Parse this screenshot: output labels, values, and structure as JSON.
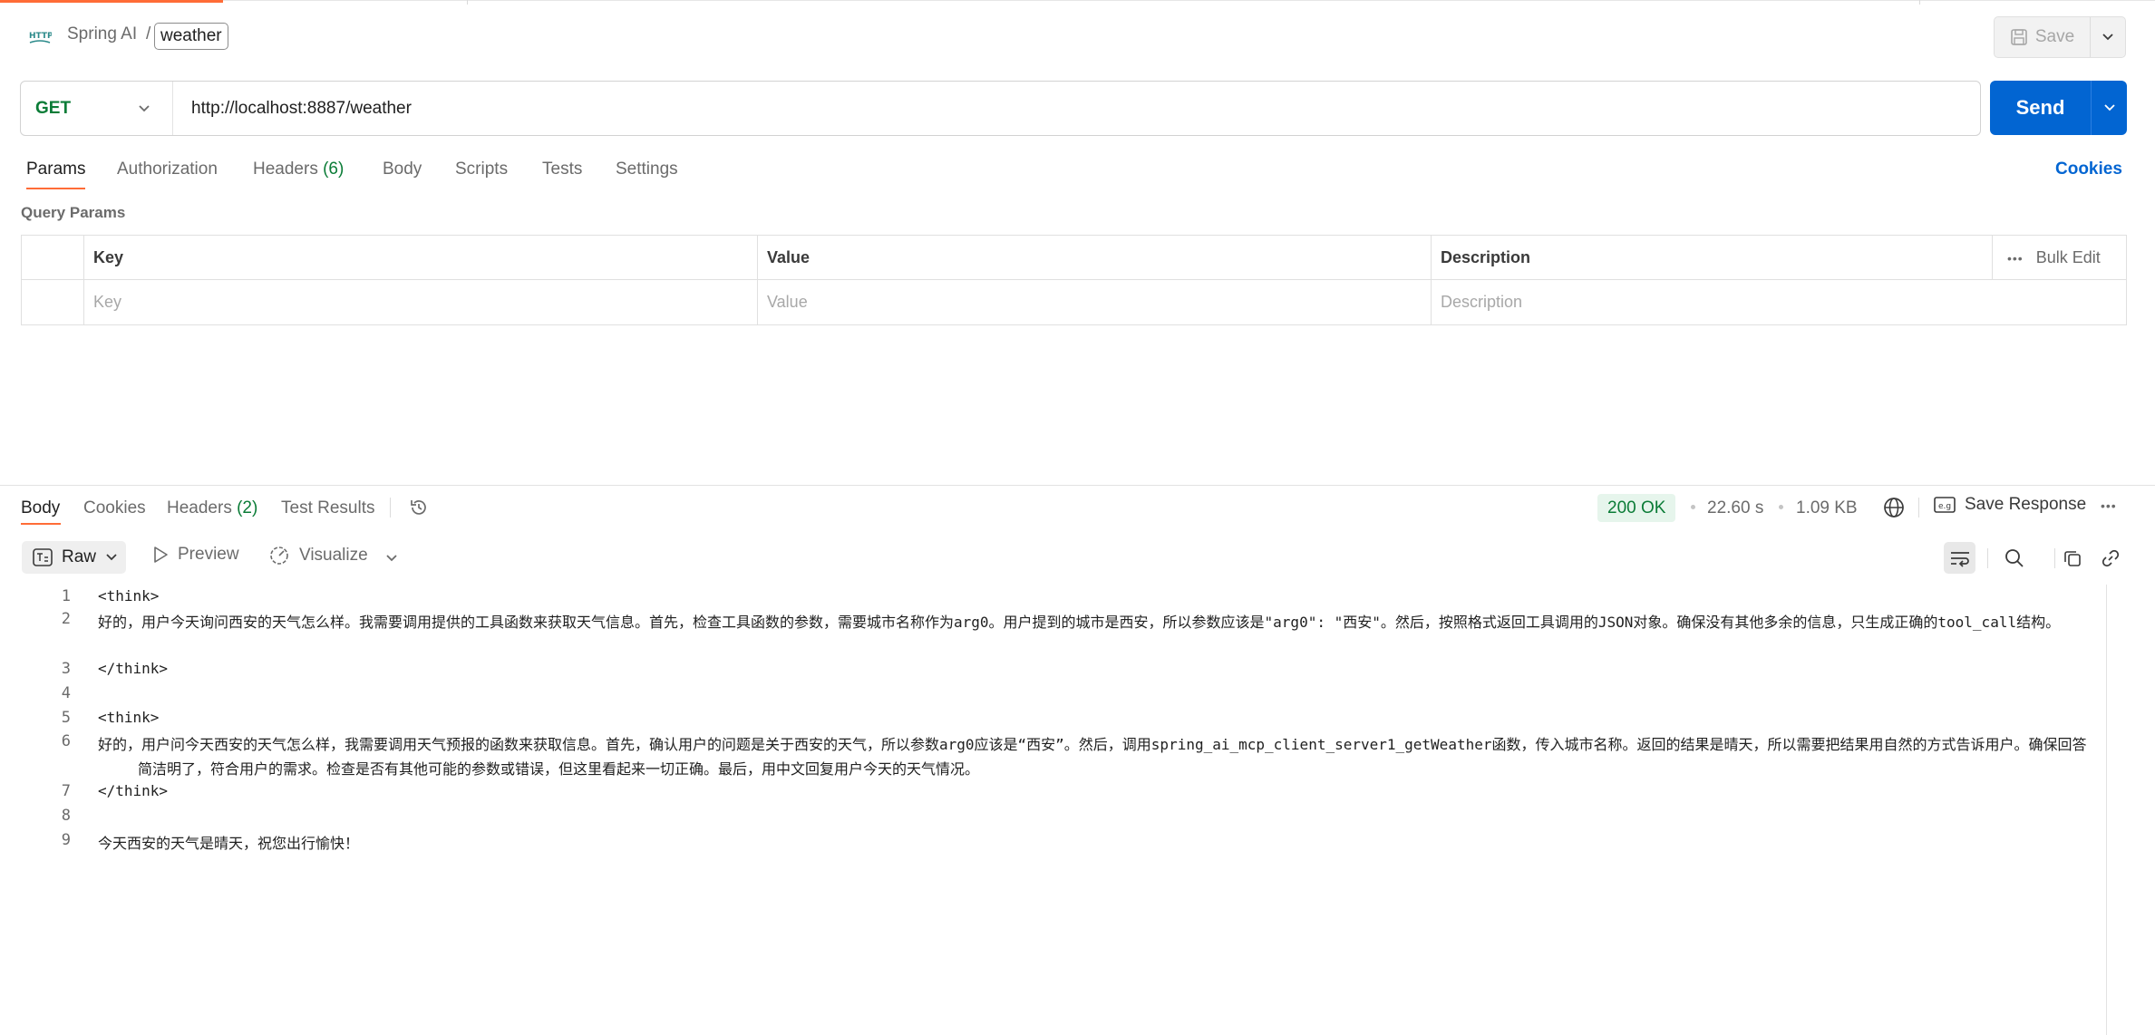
{
  "breadcrumb": {
    "collection": "Spring AI",
    "separator": "/",
    "request_name": "weather"
  },
  "toolbar": {
    "save_label": "Save"
  },
  "request": {
    "method": "GET",
    "url": "http://localhost:8887/weather",
    "send_label": "Send",
    "tabs": [
      {
        "label": "Params",
        "count": ""
      },
      {
        "label": "Authorization",
        "count": ""
      },
      {
        "label": "Headers",
        "count": "(6)"
      },
      {
        "label": "Body",
        "count": ""
      },
      {
        "label": "Scripts",
        "count": ""
      },
      {
        "label": "Tests",
        "count": ""
      },
      {
        "label": "Settings",
        "count": ""
      }
    ],
    "cookies_label": "Cookies"
  },
  "params": {
    "title": "Query Params",
    "headers": {
      "key": "Key",
      "value": "Value",
      "description": "Description",
      "bulk_edit": "Bulk Edit"
    },
    "placeholders": {
      "key": "Key",
      "value": "Value",
      "description": "Description"
    }
  },
  "response": {
    "tabs": [
      {
        "label": "Body",
        "count": ""
      },
      {
        "label": "Cookies",
        "count": ""
      },
      {
        "label": "Headers",
        "count": "(2)"
      },
      {
        "label": "Test Results",
        "count": ""
      }
    ],
    "status": "200 OK",
    "time": "22.60 s",
    "size": "1.09 KB",
    "save_response_label": "Save Response",
    "format": "Raw",
    "preview_label": "Preview",
    "visualize_label": "Visualize",
    "lines": [
      {
        "n": "1",
        "text": "<think>"
      },
      {
        "n": "2",
        "text": "好的，用户今天询问西安的天气怎么样。我需要调用提供的工具函数来获取天气信息。首先，检查工具函数的参数，需要城市名称作为arg0。用户提到的城市是西安，所以参数应该是\"arg0\": \"西安\"。然后，按照格式返回工具调用的JSON对象。确保没有其他多余的信息，只生成正确的tool_call结构。"
      },
      {
        "n": "3",
        "text": "</think>"
      },
      {
        "n": "4",
        "text": ""
      },
      {
        "n": "5",
        "text": "<think>"
      },
      {
        "n": "6",
        "text": "好的，用户问今天西安的天气怎么样，我需要调用天气预报的函数来获取信息。首先，确认用户的问题是关于西安的天气，所以参数arg0应该是“西安”。然后，调用spring_ai_mcp_client_server1_getWeather函数，传入城市名称。返回的结果是晴天，所以需要把结果用自然的方式告诉用户。确保回答简洁明了，符合用户的需求。检查是否有其他可能的参数或错误，但这里看起来一切正确。最后，用中文回复用户今天的天气情况。"
      },
      {
        "n": "7",
        "text": "</think>"
      },
      {
        "n": "8",
        "text": ""
      },
      {
        "n": "9",
        "text": "今天西安的天气是晴天，祝您出行愉快！"
      }
    ]
  },
  "colors": {
    "accent": "#ff6c37",
    "send": "#0265d2",
    "get": "#0b7c37",
    "status_ok_bg": "#e6f5ec"
  },
  "icons": [
    "http-icon",
    "save-icon",
    "chevron-down-icon",
    "history-icon",
    "globe-icon",
    "save-response-icon",
    "more-icon",
    "raw-icon",
    "play-icon",
    "visualize-icon",
    "wrap-icon",
    "search-icon",
    "copy-icon",
    "link-icon"
  ]
}
